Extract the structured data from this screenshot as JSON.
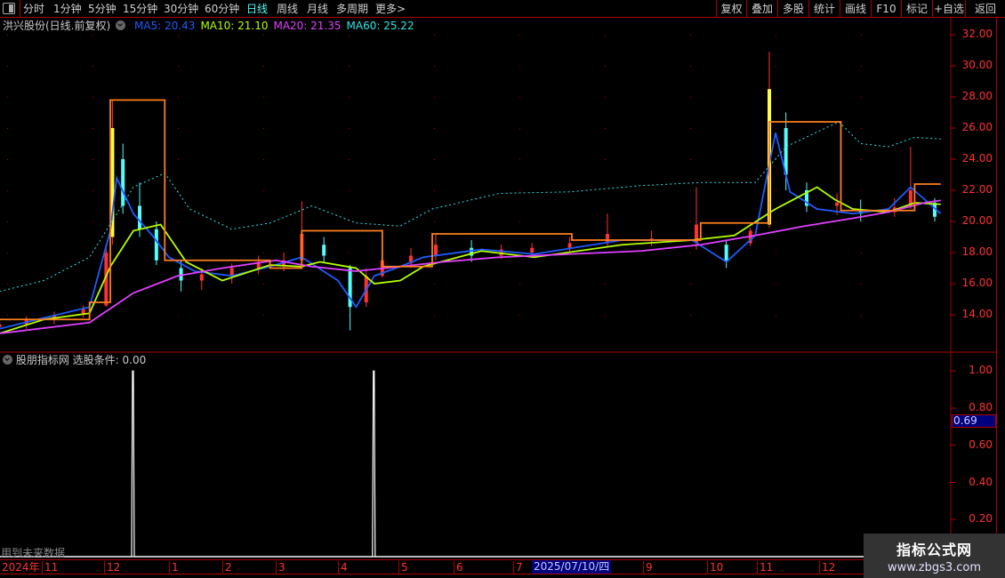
{
  "toolbar": {
    "periods": [
      "分时",
      "1分钟",
      "5分钟",
      "15分钟",
      "30分钟",
      "60分钟",
      "日线",
      "周线",
      "月线",
      "多周期",
      "更多>"
    ],
    "active": "日线",
    "right_buttons": [
      "复权",
      "叠加",
      "多股",
      "统计",
      "画线",
      "F10",
      "标记",
      "+自选",
      "返回"
    ]
  },
  "main_panel": {
    "title": "洪兴股份(日线.前复权)",
    "ma": [
      {
        "label": "MA5: 20.43",
        "color": "#1e5cff"
      },
      {
        "label": "MA10: 21.10",
        "color": "#b4ff00"
      },
      {
        "label": "MA20: 21.35",
        "color": "#e040ff"
      },
      {
        "label": "MA60: 25.22",
        "color": "#2ee6e6"
      }
    ]
  },
  "sub_panel": {
    "title": "股朋指标网",
    "formula": "选股条件: 0.00",
    "current_value": "0.69",
    "warning": "用到未来数据"
  },
  "date_axis": {
    "year": "2024年",
    "months": [
      "11",
      "12",
      "1",
      "2",
      "3",
      "4",
      "5",
      "6",
      "7",
      "9",
      "10",
      "11",
      "12"
    ],
    "cursor_date": "2025/07/10/四"
  },
  "watermark": {
    "line1": "指标公式网",
    "line2": "www.zbgs3.com"
  },
  "colors": {
    "up": "#ff3232",
    "down": "#54fcfc",
    "step": "#ff7f1e",
    "axis": "#aa0000"
  },
  "chart_data": [
    {
      "type": "candlestick",
      "title": "洪兴股份(日线.前复权)",
      "ylim": [
        12.5,
        33
      ],
      "yticks": [
        "32.00",
        "30.00",
        "28.00",
        "26.00",
        "24.00",
        "22.00",
        "20.00",
        "18.00",
        "16.00",
        "14.00"
      ],
      "xlim": [
        "2024-10-10",
        "2026-01-31"
      ],
      "candles": [
        [
          "2024-10-10",
          13.2,
          13.6,
          12.9,
          13.4
        ],
        [
          "2024-10-24",
          13.4,
          13.9,
          13.1,
          13.7
        ],
        [
          "2024-11-07",
          13.7,
          14.2,
          13.4,
          14.0
        ],
        [
          "2024-11-21",
          14.0,
          14.6,
          13.8,
          14.4
        ],
        [
          "2024-12-02",
          14.6,
          18.5,
          14.5,
          18.0
        ],
        [
          "2024-12-05",
          19.0,
          27.8,
          18.5,
          26.0
        ],
        [
          "2024-12-10",
          24,
          25,
          20.5,
          21
        ],
        [
          "2024-12-18",
          21,
          22.5,
          19,
          19.5
        ],
        [
          "2024-12-26",
          19.5,
          20,
          17.2,
          17.5
        ],
        [
          "2025-01-08",
          17,
          17.5,
          15.5,
          16.2
        ],
        [
          "2025-01-20",
          16.2,
          17,
          15.6,
          16.6
        ],
        [
          "2025-02-06",
          16.5,
          17.3,
          16,
          17
        ],
        [
          "2025-02-20",
          17,
          17.8,
          16.6,
          17.4
        ],
        [
          "2025-03-05",
          17.2,
          18,
          16.8,
          17.5
        ],
        [
          "2025-03-14",
          17.5,
          21.3,
          17.2,
          19.2
        ],
        [
          "2025-03-25",
          18.5,
          19,
          17.4,
          17.8
        ],
        [
          "2025-04-07",
          17,
          17.2,
          13,
          14.5
        ],
        [
          "2025-04-15",
          14.8,
          17,
          14.5,
          16.5
        ],
        [
          "2025-04-23",
          16.5,
          19.5,
          16.4,
          17.5
        ],
        [
          "2025-05-08",
          17.3,
          18.3,
          17,
          17.8
        ],
        [
          "2025-05-22",
          17.8,
          19.2,
          17.5,
          18.5
        ],
        [
          "2025-06-10",
          18.3,
          18.8,
          17.4,
          17.8
        ],
        [
          "2025-06-25",
          17.8,
          18.5,
          17.6,
          18.2
        ],
        [
          "2025-07-10",
          18,
          18.6,
          17.8,
          18.3
        ],
        [
          "2025-07-28",
          18.3,
          19,
          18,
          18.6
        ],
        [
          "2025-08-15",
          18.6,
          20.5,
          18.4,
          19.2
        ],
        [
          "2025-09-05",
          18.8,
          19.4,
          18.4,
          18.9
        ],
        [
          "2025-09-26",
          18.6,
          22.2,
          18.2,
          19.8
        ],
        [
          "2025-10-13",
          18.5,
          18.8,
          17,
          17.4
        ],
        [
          "2025-10-28",
          18.6,
          19.6,
          18.4,
          19.4
        ],
        [
          "2025-11-07",
          19.8,
          30.9,
          19.6,
          28.5
        ],
        [
          "2025-11-15",
          26,
          27,
          22,
          23
        ],
        [
          "2025-11-25",
          22,
          22.5,
          20.6,
          21
        ],
        [
          "2025-12-10",
          21,
          21.8,
          20.4,
          21.2
        ],
        [
          "2025-12-22",
          20.8,
          21.4,
          20,
          20.5
        ],
        [
          "2026-01-08",
          20.6,
          21.5,
          20.3,
          20.9
        ],
        [
          "2026-01-16",
          21,
          24.8,
          20.8,
          22
        ],
        [
          "2026-01-28",
          21.2,
          21.5,
          20,
          20.3
        ]
      ],
      "series": [
        {
          "name": "MA5",
          "color": "#1e5cff",
          "points": [
            [
              "2024-10-10",
              13.1
            ],
            [
              "2024-11-02",
              13.8
            ],
            [
              "2024-11-24",
              14.5
            ],
            [
              "2024-12-04",
              19.4
            ],
            [
              "2024-12-07",
              22.8
            ],
            [
              "2024-12-15",
              20.5
            ],
            [
              "2024-12-24",
              19.1
            ],
            [
              "2025-01-01",
              17.7
            ],
            [
              "2025-01-16",
              16.8
            ],
            [
              "2025-02-06",
              16.5
            ],
            [
              "2025-02-26",
              17.1
            ],
            [
              "2025-03-14",
              17.7
            ],
            [
              "2025-04-01",
              16.2
            ],
            [
              "2025-04-10",
              14.5
            ],
            [
              "2025-04-19",
              16.5
            ],
            [
              "2025-05-02",
              17.1
            ],
            [
              "2025-05-15",
              17.7
            ],
            [
              "2025-06-15",
              18.2
            ],
            [
              "2025-07-11",
              17.9
            ],
            [
              "2025-08-22",
              18.8
            ],
            [
              "2025-09-24",
              18.8
            ],
            [
              "2025-10-13",
              17.4
            ],
            [
              "2025-10-31",
              19.1
            ],
            [
              "2025-11-10",
              25.7
            ],
            [
              "2025-11-17",
              21.9
            ],
            [
              "2025-11-30",
              20.8
            ],
            [
              "2025-12-18",
              20.5
            ],
            [
              "2026-01-05",
              20.8
            ],
            [
              "2026-01-16",
              22.2
            ],
            [
              "2026-01-31",
              20.5
            ]
          ]
        },
        {
          "name": "MA10",
          "color": "#b4ff00",
          "points": [
            [
              "2024-10-10",
              12.8
            ],
            [
              "2024-11-02",
              13.7
            ],
            [
              "2024-11-24",
              14.1
            ],
            [
              "2024-12-04",
              17.1
            ],
            [
              "2024-12-15",
              19.4
            ],
            [
              "2024-12-28",
              19.8
            ],
            [
              "2025-01-11",
              17.4
            ],
            [
              "2025-02-01",
              16.2
            ],
            [
              "2025-02-26",
              17.2
            ],
            [
              "2025-03-14",
              17.1
            ],
            [
              "2025-03-23",
              17.4
            ],
            [
              "2025-04-10",
              17.0
            ],
            [
              "2025-04-19",
              16.0
            ],
            [
              "2025-05-02",
              16.2
            ],
            [
              "2025-05-15",
              17.1
            ],
            [
              "2025-06-15",
              18.1
            ],
            [
              "2025-07-11",
              17.7
            ],
            [
              "2025-08-22",
              18.5
            ],
            [
              "2025-09-24",
              18.8
            ],
            [
              "2025-10-18",
              19.1
            ],
            [
              "2025-11-10",
              20.8
            ],
            [
              "2025-11-30",
              22.2
            ],
            [
              "2025-12-09",
              21.4
            ],
            [
              "2025-12-18",
              20.8
            ],
            [
              "2026-01-05",
              20.6
            ],
            [
              "2026-01-18",
              21.2
            ],
            [
              "2026-01-31",
              21.1
            ]
          ]
        },
        {
          "name": "MA20",
          "color": "#e040ff",
          "points": [
            [
              "2024-10-10",
              12.8
            ],
            [
              "2024-11-24",
              13.5
            ],
            [
              "2024-12-15",
              15.4
            ],
            [
              "2025-01-06",
              16.5
            ],
            [
              "2025-02-01",
              17.0
            ],
            [
              "2025-03-01",
              17.5
            ],
            [
              "2025-03-19",
              17.1
            ],
            [
              "2025-04-10",
              16.8
            ],
            [
              "2025-05-02",
              17.1
            ],
            [
              "2025-05-26",
              17.4
            ],
            [
              "2025-06-24",
              17.7
            ],
            [
              "2025-07-28",
              17.9
            ],
            [
              "2025-08-31",
              18.1
            ],
            [
              "2025-09-28",
              18.5
            ],
            [
              "2025-10-31",
              19.1
            ],
            [
              "2025-11-24",
              19.7
            ],
            [
              "2025-12-18",
              20.2
            ],
            [
              "2026-01-05",
              20.6
            ],
            [
              "2026-01-23",
              21.2
            ],
            [
              "2026-01-31",
              21.35
            ]
          ]
        },
        {
          "name": "MA60",
          "color": "#2ee6e6",
          "dashed": true,
          "points": [
            [
              "2024-10-10",
              15.5
            ],
            [
              "2024-11-02",
              16.2
            ],
            [
              "2024-11-24",
              17.7
            ],
            [
              "2024-12-15",
              22.2
            ],
            [
              "2024-12-30",
              23.1
            ],
            [
              "2025-01-13",
              20.8
            ],
            [
              "2025-02-06",
              19.5
            ],
            [
              "2025-02-26",
              19.9
            ],
            [
              "2025-03-19",
              21.0
            ],
            [
              "2025-04-10",
              19.9
            ],
            [
              "2025-05-02",
              19.7
            ],
            [
              "2025-05-20",
              20.8
            ],
            [
              "2025-06-24",
              21.8
            ],
            [
              "2025-07-28",
              21.9
            ],
            [
              "2025-08-31",
              22.3
            ],
            [
              "2025-09-28",
              22.5
            ],
            [
              "2025-10-31",
              22.5
            ],
            [
              "2025-11-15",
              24.8
            ],
            [
              "2025-12-11",
              26.4
            ],
            [
              "2025-12-22",
              25.0
            ],
            [
              "2026-01-05",
              24.8
            ],
            [
              "2026-01-18",
              25.4
            ],
            [
              "2026-01-31",
              25.3
            ]
          ]
        },
        {
          "name": "step",
          "color": "#ff7f1e",
          "step": true,
          "points": [
            [
              "2024-10-10",
              13.7
            ],
            [
              "2024-11-24",
              14.8
            ],
            [
              "2024-12-04",
              27.8
            ],
            [
              "2024-12-30",
              17.5
            ],
            [
              "2025-02-26",
              17.0
            ],
            [
              "2025-03-14",
              19.4
            ],
            [
              "2025-04-23",
              17.1
            ],
            [
              "2025-05-20",
              19.2
            ],
            [
              "2025-07-29",
              18.8
            ],
            [
              "2025-09-28",
              19.9
            ],
            [
              "2025-11-07",
              26.4
            ],
            [
              "2025-12-12",
              20.7
            ],
            [
              "2026-01-18",
              22.4
            ],
            [
              "2026-01-31",
              22.4
            ]
          ]
        }
      ]
    },
    {
      "type": "line",
      "title": "股朋指标网",
      "ylim": [
        0,
        1.05
      ],
      "yticks": [
        "1.00",
        "0.80",
        "0.60",
        "0.40",
        "0.20"
      ],
      "spikes": [
        [
          "2024-12-15",
          1.0
        ],
        [
          "2025-04-19",
          1.0
        ]
      ]
    }
  ]
}
